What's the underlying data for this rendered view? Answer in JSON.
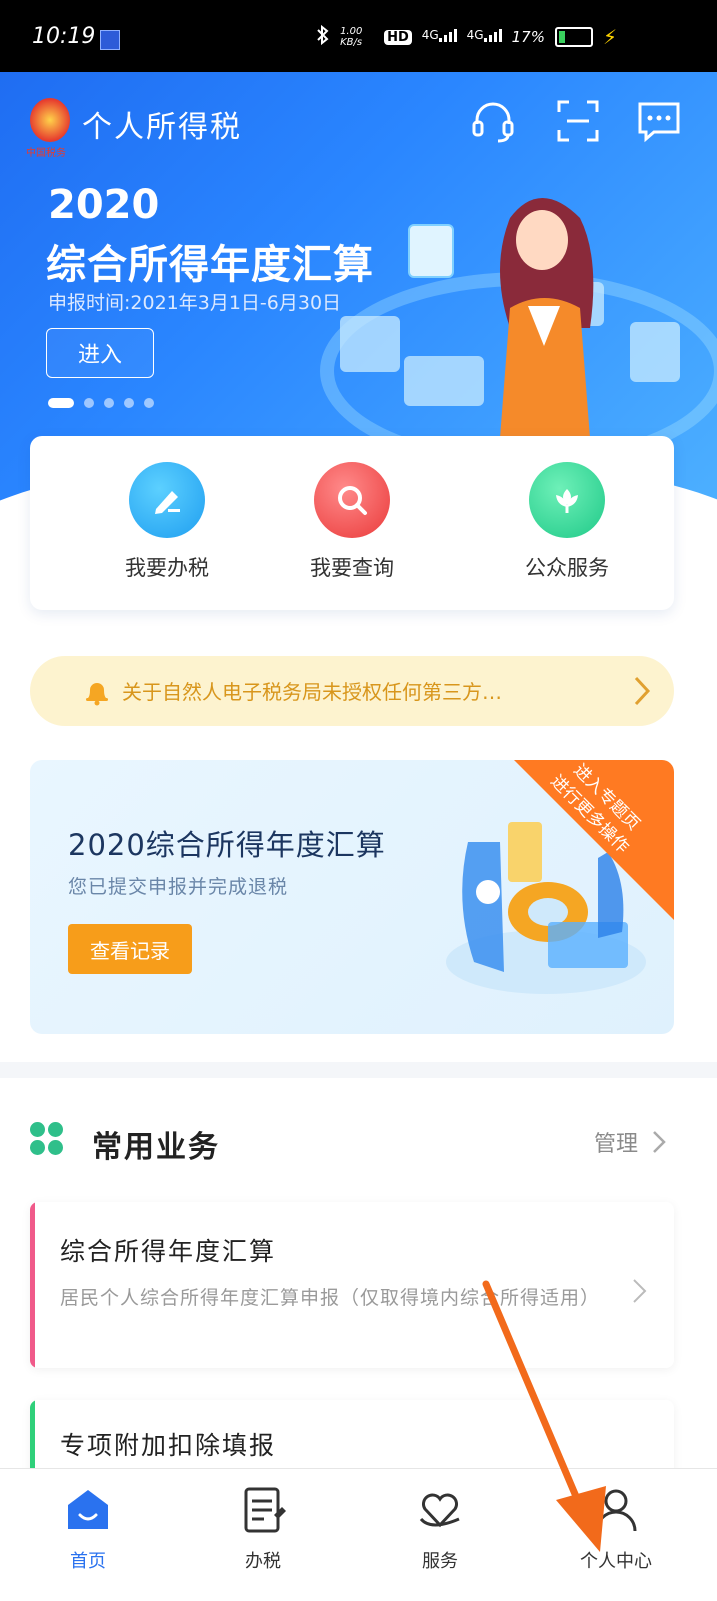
{
  "status_bar": {
    "time": "10:19",
    "net_speed": "1.00 KB/s",
    "hd": "HD",
    "sim1": "4G",
    "sim2": "4G",
    "battery": "17%"
  },
  "header": {
    "logo_caption": "中国税务",
    "app_title": "个人所得税",
    "icons": [
      "headset-icon",
      "scan-icon",
      "message-icon"
    ]
  },
  "hero": {
    "year": "2020",
    "headline": "综合所得年度汇算",
    "period": "申报时间:2021年3月1日-6月30日",
    "enter_label": "进入",
    "slide_count": 5,
    "active_slide": 1
  },
  "quick_actions": [
    {
      "label": "我要办税",
      "icon": "edit-icon",
      "color": "#1fa9f0"
    },
    {
      "label": "我要查询",
      "icon": "search-icon",
      "color": "#f04a4a"
    },
    {
      "label": "公众服务",
      "icon": "flower-icon",
      "color": "#1fcf8f"
    }
  ],
  "notice": {
    "text": "关于自然人电子税务局未授权任何第三方…"
  },
  "annual_banner": {
    "title": "2020综合所得年度汇算",
    "subtitle": "您已提交申报并完成退税",
    "button_label": "查看记录",
    "corner_line1": "进入专题页",
    "corner_line2": "进行更多操作"
  },
  "common_business": {
    "title": "常用业务",
    "manage_label": "管理",
    "items": [
      {
        "name": "综合所得年度汇算",
        "desc": "居民个人综合所得年度汇算申报（仅取得境内综合所得适用）",
        "accent": "#f05a8a"
      },
      {
        "name": "专项附加扣除填报",
        "desc": "",
        "accent": "#2fd07a"
      }
    ]
  },
  "tab_bar": {
    "tabs": [
      {
        "label": "首页",
        "icon": "home-icon",
        "active": true
      },
      {
        "label": "办税",
        "icon": "document-icon",
        "active": false
      },
      {
        "label": "服务",
        "icon": "heart-hand-icon",
        "active": false
      },
      {
        "label": "个人中心",
        "icon": "user-icon",
        "active": false
      }
    ]
  },
  "colors": {
    "primary": "#2a72ef",
    "orange": "#f79d1a",
    "annotation_arrow": "#f26a1b"
  }
}
